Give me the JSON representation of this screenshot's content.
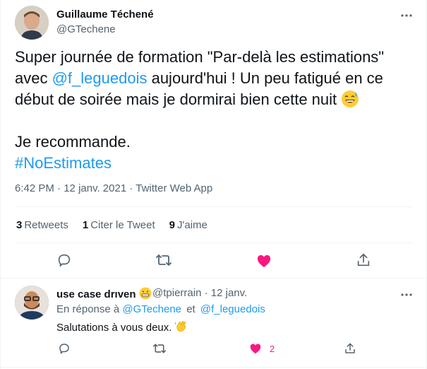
{
  "tweet": {
    "author_name": "Guillaume Téchené",
    "author_handle": "@GTechene",
    "text_part1": "Super journée de formation \"Par-delà les estimations\" avec ",
    "mention": "@f_leguedois",
    "text_part2": " aujourd'hui ! Un peu fatigué en ce début de soirée mais je dormirai bien cette nuit ",
    "text_part3": "\n\nJe recommande.\n",
    "hashtag": "#NoEstimates",
    "time": "6:42 PM",
    "dot1": "·",
    "date": "12 janv. 2021",
    "dot2": "·",
    "client": "Twitter Web App",
    "emoji_icon": "grinning-sweat-icon"
  },
  "stats": {
    "retweets_count": "3",
    "retweets_label": "Retweets",
    "quotes_count": "1",
    "quotes_label": "Citer le Tweet",
    "likes_count": "9",
    "likes_label": "J'aime"
  },
  "actions": {
    "icons": [
      "reply-icon",
      "retweet-icon",
      "like-icon",
      "share-icon"
    ],
    "like_color": "#f91880"
  },
  "reply": {
    "author_name": "use case drıven",
    "author_emoji_icon": "grimacing-icon",
    "author_handle": "@tpierrain",
    "dot": "·",
    "date": "12 janv.",
    "in_reply_prefix": "En réponse à",
    "in_reply_user1": "@GTechene",
    "in_reply_and": "et",
    "in_reply_user2": "@f_leguedois",
    "text": "Salutations à vous deux.",
    "text_emoji_icon": "waving-hand-icon",
    "like_count": "2"
  },
  "colors": {
    "link": "#1d9bf0",
    "secondary": "#536471",
    "primary": "#0f1419",
    "border": "#eff3f4"
  }
}
